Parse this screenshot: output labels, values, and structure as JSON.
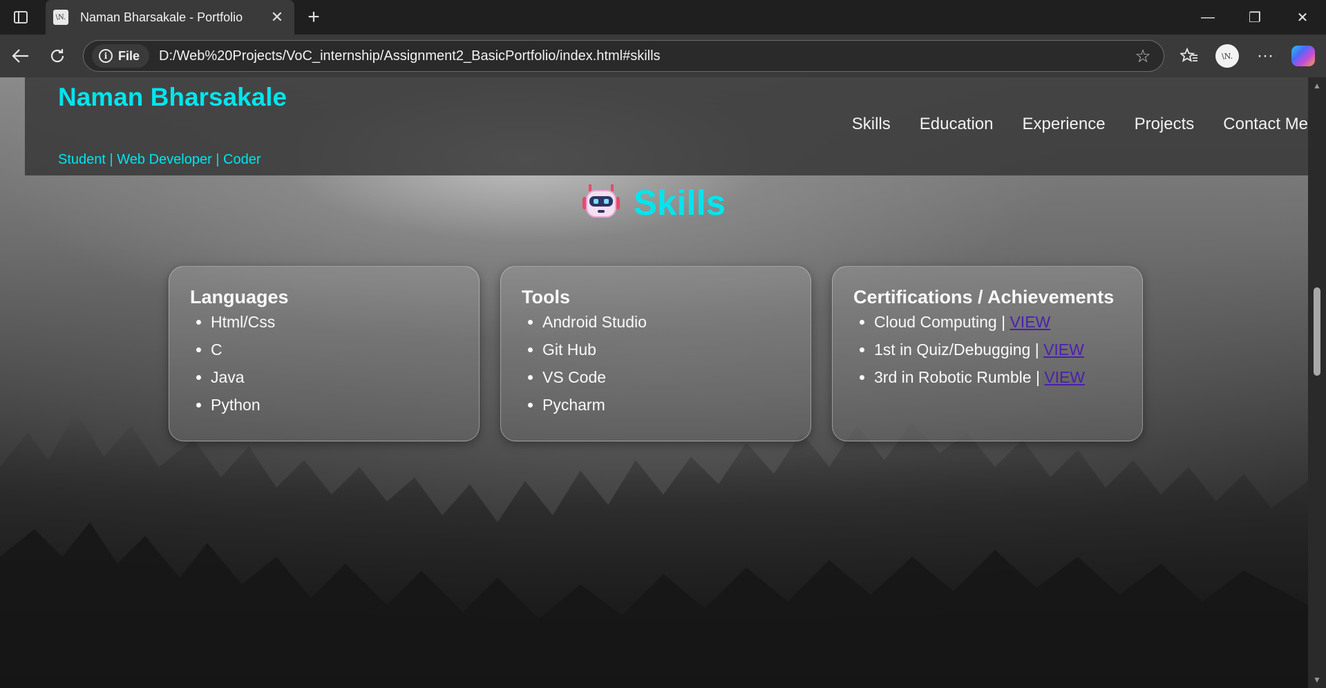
{
  "browser": {
    "tab_title": "Naman Bharsakale - Portfolio",
    "favicon_text": "\\N.",
    "site_info_label": "File",
    "url": "D:/Web%20Projects/VoC_internship/Assignment2_BasicPortfolio/index.html#skills",
    "profile_text": "\\N."
  },
  "header": {
    "name": "Naman Bharsakale",
    "tagline": "Student | Web Developer | Coder",
    "nav": [
      "Skills",
      "Education",
      "Experience",
      "Projects",
      "Contact Me"
    ]
  },
  "skills": {
    "title": "Skills",
    "cards": [
      {
        "heading": "Languages",
        "items": [
          "Html/Css",
          "C",
          "Java",
          "Python"
        ]
      },
      {
        "heading": "Tools",
        "items": [
          "Android Studio",
          "Git Hub",
          "VS Code",
          "Pycharm"
        ]
      },
      {
        "heading": "Certifications / Achievements",
        "items": [
          {
            "text": "Cloud Computing | ",
            "link": "VIEW"
          },
          {
            "text": "1st in Quiz/Debugging | ",
            "link": "VIEW"
          },
          {
            "text": "3rd in Robotic Rumble | ",
            "link": "VIEW"
          }
        ]
      }
    ]
  },
  "colors": {
    "accent": "#00e5ee",
    "link": "#4a1fb0"
  }
}
